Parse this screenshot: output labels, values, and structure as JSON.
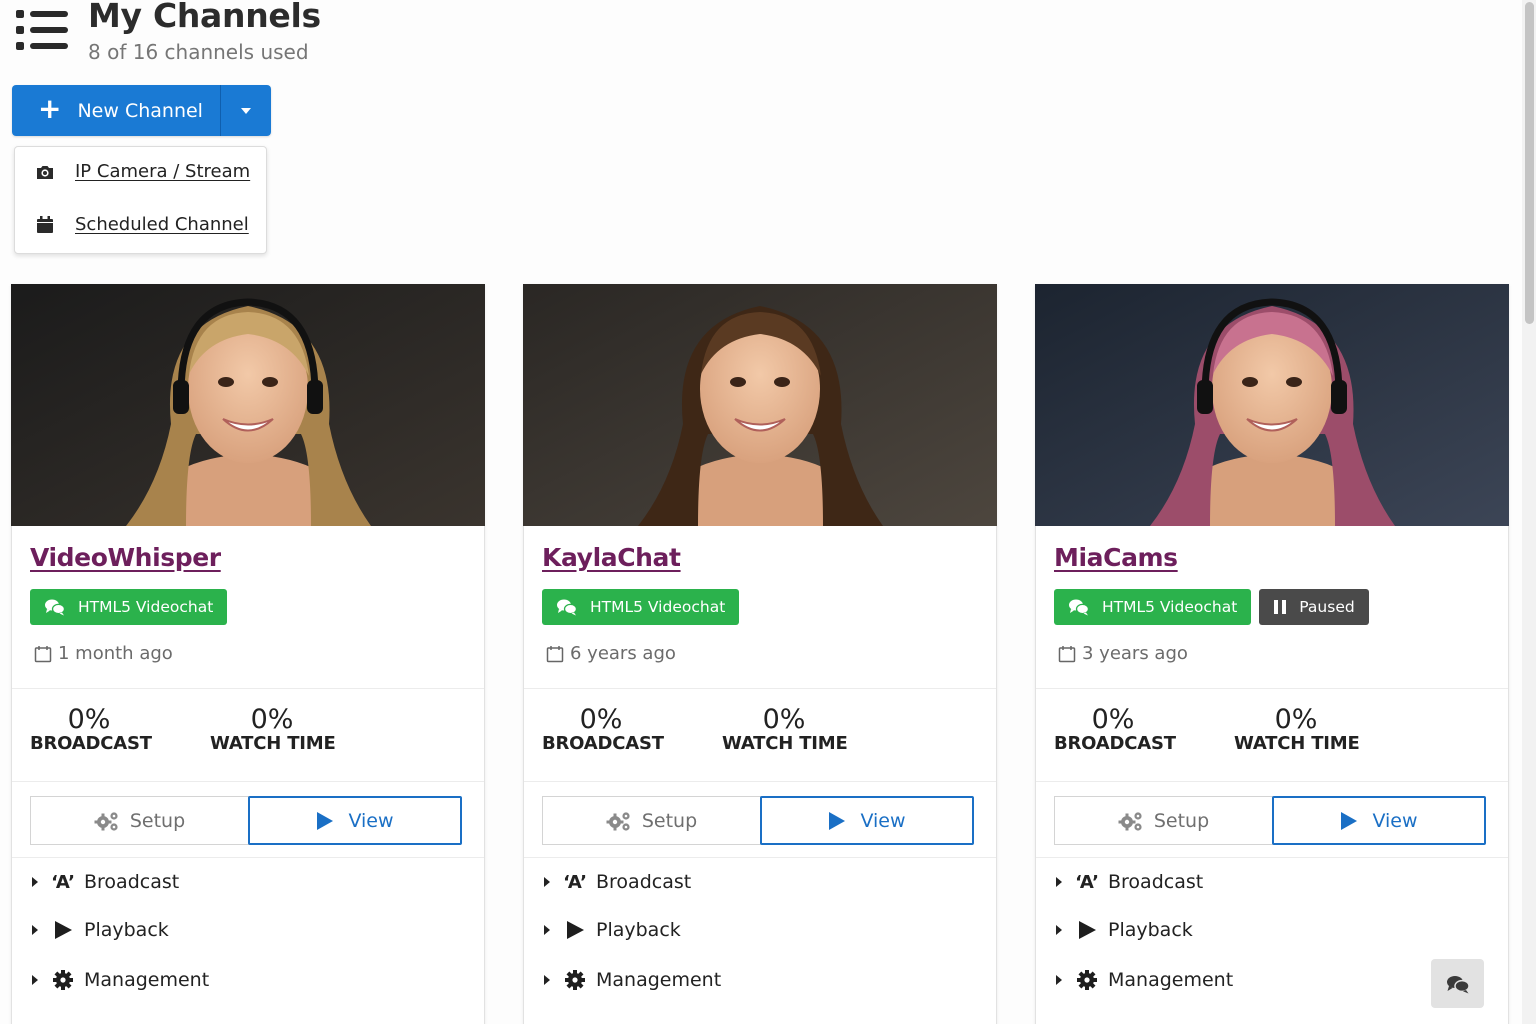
{
  "header": {
    "title": "My Channels",
    "subtitle": "8 of 16 channels used",
    "icon": "list-icon"
  },
  "new_channel": {
    "label": "New Channel",
    "plus": "+",
    "menu": [
      {
        "label": "IP Camera / Stream",
        "icon": "camera-icon"
      },
      {
        "label": "Scheduled Channel",
        "icon": "calendar-icon"
      }
    ]
  },
  "colors": {
    "primary": "#1a7ad4",
    "success": "#2bb24c",
    "paused": "#4a4a4a",
    "title_link": "#6d1f5c"
  },
  "channels": [
    {
      "name": "VideoWhisper",
      "badge": "HTML5 Videochat",
      "paused": "",
      "date": "1 month ago",
      "broadcast_value": "0%",
      "broadcast_label": "BROADCAST",
      "watch_value": "0%",
      "watch_label": "WATCH TIME",
      "setup": "Setup",
      "view": "View",
      "sections": [
        "Broadcast",
        "Playback",
        "Management"
      ]
    },
    {
      "name": "KaylaChat",
      "badge": "HTML5 Videochat",
      "paused": "",
      "date": "6 years ago",
      "broadcast_value": "0%",
      "broadcast_label": "BROADCAST",
      "watch_value": "0%",
      "watch_label": "WATCH TIME",
      "setup": "Setup",
      "view": "View",
      "sections": [
        "Broadcast",
        "Playback",
        "Management"
      ]
    },
    {
      "name": "MiaCams",
      "badge": "HTML5 Videochat",
      "paused": "Paused",
      "date": "3 years ago",
      "broadcast_value": "0%",
      "broadcast_label": "BROADCAST",
      "watch_value": "0%",
      "watch_label": "WATCH TIME",
      "setup": "Setup",
      "view": "View",
      "sections": [
        "Broadcast",
        "Playback",
        "Management"
      ]
    }
  ],
  "section_icons": {
    "broadcast_glyph": "‘A’"
  }
}
